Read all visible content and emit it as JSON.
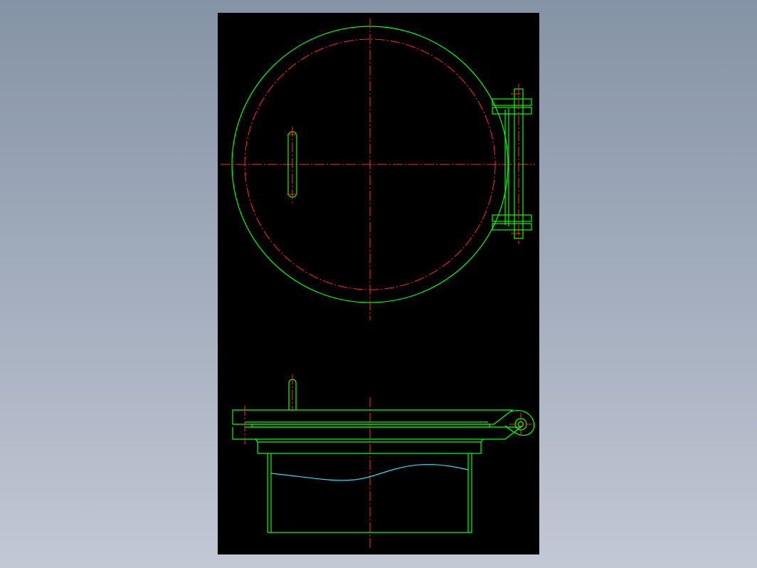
{
  "drawing": {
    "background_color": "#000000",
    "outline_color": "#00ff00",
    "centerline_color": "#ff2a2a",
    "break_line_color": "#33ddee",
    "views": [
      "plan-view",
      "side-section-view"
    ]
  }
}
